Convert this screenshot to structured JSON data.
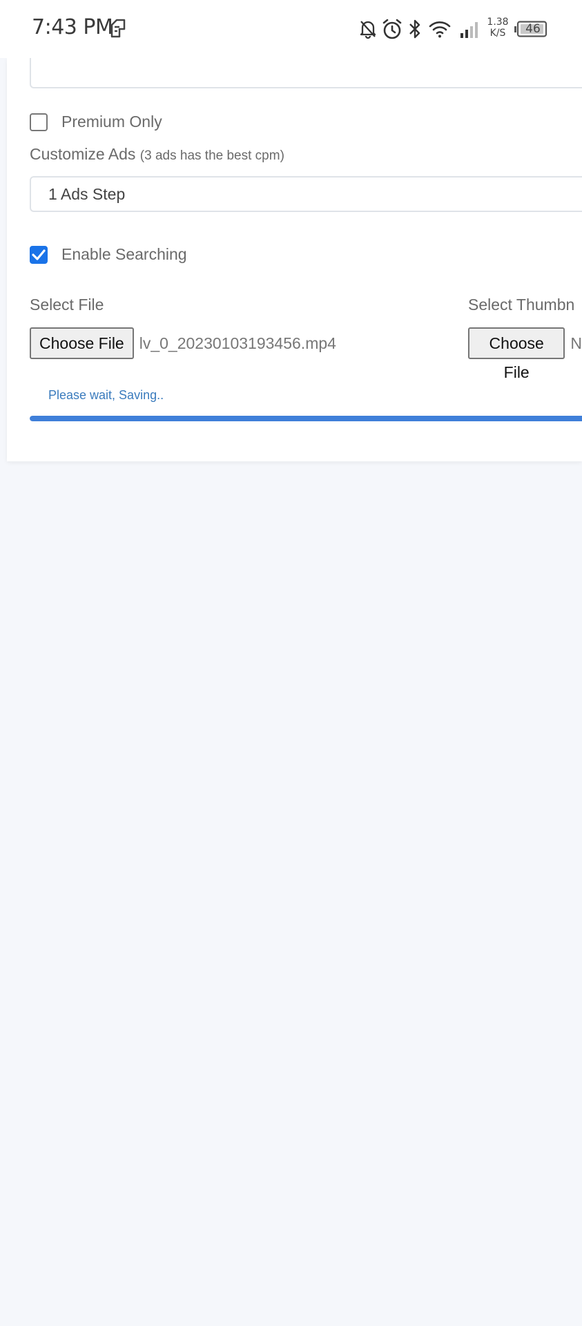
{
  "status_bar": {
    "time": "7:43 PM",
    "speed_value": "1.38",
    "speed_unit": "K/S",
    "battery": "46",
    "icons": [
      "sim-card-icon",
      "notifications-off-icon",
      "alarm-icon",
      "bluetooth-icon",
      "wifi-icon",
      "signal-icon",
      "battery-icon"
    ]
  },
  "form": {
    "top_input_value": "",
    "premium_only": {
      "label": "Premium Only",
      "checked": false
    },
    "customize_ads": {
      "label": "Customize Ads",
      "hint": "(3 ads has the best cpm)",
      "selected": "1 Ads Step"
    },
    "enable_searching": {
      "label": "Enable Searching",
      "checked": true
    },
    "select_file": {
      "label": "Select File",
      "button": "Choose File",
      "file_name": "lv_0_20230103193456.mp4"
    },
    "select_thumbnail": {
      "label": "Select Thumbn",
      "button": "Choose File",
      "file_name": "N"
    },
    "saving_message": "Please wait, Saving..",
    "progress_percent": 100
  },
  "colors": {
    "accent": "#1a73e8",
    "progress": "#3f7fd9",
    "background": "#f5f7fb"
  }
}
